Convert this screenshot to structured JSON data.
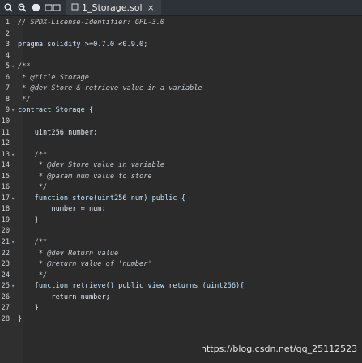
{
  "toolbar": {
    "icons": [
      "search-icon",
      "zoom-icon",
      "app-icon",
      "split-icon"
    ],
    "tab_filename": "1_Storage.sol",
    "tab_close": "×"
  },
  "gutter": {
    "line_numbers": [
      "1",
      "2",
      "3",
      "4",
      "5",
      "6",
      "7",
      "8",
      "9",
      "10",
      "11",
      "12",
      "13",
      "14",
      "15",
      "16",
      "17",
      "18",
      "19",
      "20",
      "21",
      "22",
      "23",
      "24",
      "25",
      "26",
      "27",
      "28"
    ]
  },
  "code": {
    "l1": "// SPDX-License-Identifier: GPL-3.0",
    "l2": "",
    "l3": "pragma solidity >=0.7.0 <0.9.0;",
    "l4": "",
    "l5": "/**",
    "l6": " * @title Storage",
    "l7": " * @dev Store & retrieve value in a variable",
    "l8": " */",
    "l9": "contract Storage {",
    "l10": "",
    "l11": "    uint256 number;",
    "l12": "",
    "l13": "    /**",
    "l14": "     * @dev Store value in variable",
    "l15": "     * @param num value to store",
    "l16": "     */",
    "l17": "    function store(uint256 num) public {",
    "l18": "        number = num;",
    "l19": "    }",
    "l20": "",
    "l21": "    /**",
    "l22": "     * @dev Return value",
    "l23": "     * @return value of 'number'",
    "l24": "     */",
    "l25": "    function retrieve() public view returns (uint256){",
    "l26": "        return number;",
    "l27": "    }",
    "l28": "}"
  },
  "watermark": "https://blog.csdn.net/qq_25112523"
}
